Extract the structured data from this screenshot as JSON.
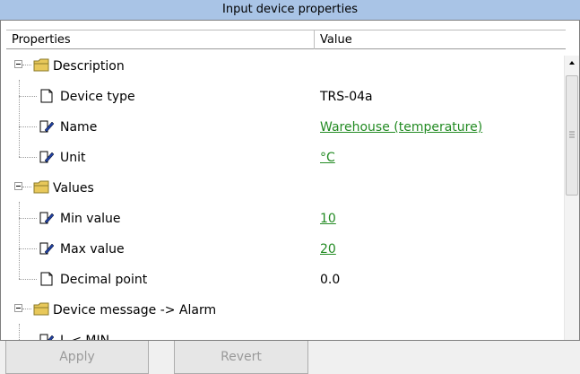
{
  "window": {
    "title": "Input device properties"
  },
  "header": {
    "properties": "Properties",
    "value": "Value"
  },
  "rows": [
    {
      "type": "category",
      "label": "Description"
    },
    {
      "type": "prop",
      "icon": "document-icon",
      "label": "Device type",
      "value": "TRS-04a",
      "editable": false
    },
    {
      "type": "prop",
      "icon": "edit-icon",
      "label": "Name",
      "value": "Warehouse (temperature)",
      "editable": true
    },
    {
      "type": "prop",
      "icon": "edit-icon",
      "label": "Unit",
      "value": "°C",
      "editable": true
    },
    {
      "type": "category",
      "label": "Values"
    },
    {
      "type": "prop",
      "icon": "edit-icon",
      "label": "Min value",
      "value": "10",
      "editable": true
    },
    {
      "type": "prop",
      "icon": "edit-icon",
      "label": "Max value",
      "value": "20",
      "editable": true
    },
    {
      "type": "prop",
      "icon": "document-icon",
      "label": "Decimal point",
      "value": "0.0",
      "editable": false
    },
    {
      "type": "category",
      "label": "Device message -> Alarm"
    },
    {
      "type": "prop",
      "icon": "edit-icon",
      "label": "L < MIN",
      "value": "",
      "editable": true
    }
  ],
  "buttons": {
    "apply": "Apply",
    "revert": "Revert"
  },
  "colors": {
    "title_bar": "#a9c4e6",
    "link": "#238b23",
    "folder": "#e8c85a"
  }
}
